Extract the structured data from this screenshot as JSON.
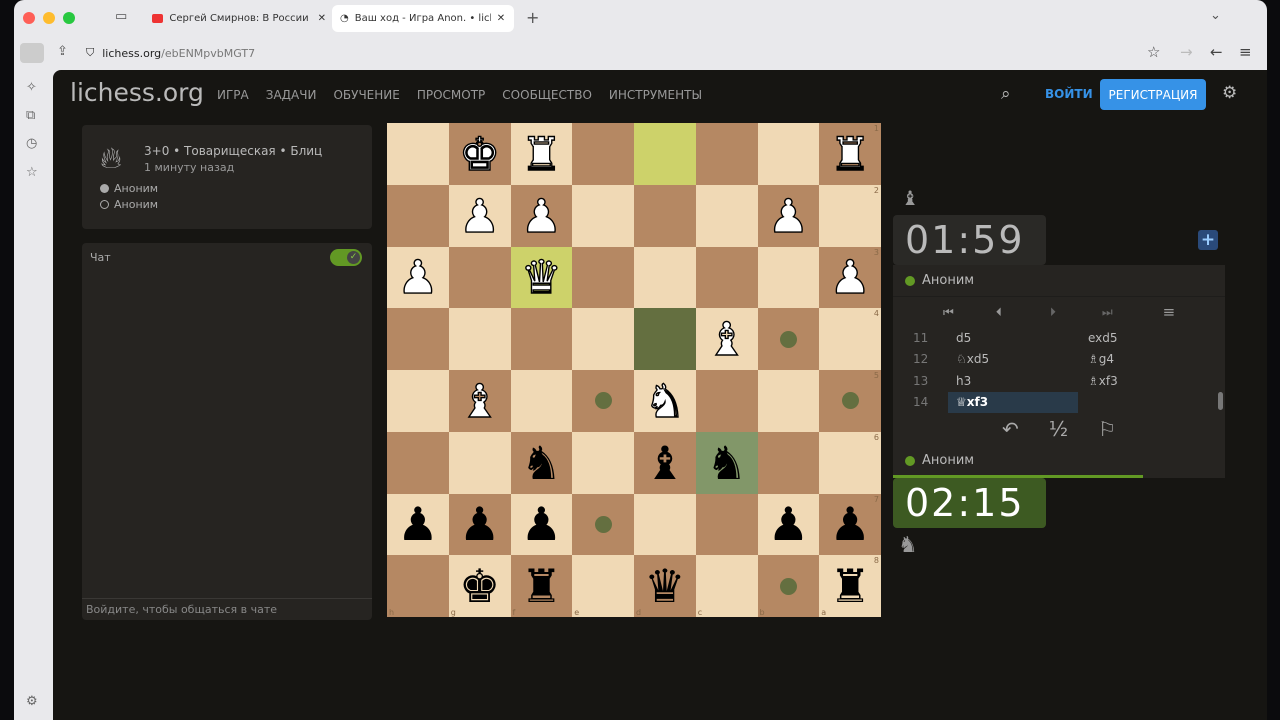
{
  "browser": {
    "tabs": [
      {
        "title": "Сергей Смирнов: В России бо"
      },
      {
        "title": "Ваш ход - Игра Anon. • lichess."
      }
    ],
    "url_host": "lichess.org",
    "url_path": "/ebENMpvbMGT7"
  },
  "header": {
    "logo": "lichess.org",
    "nav": [
      "ИГРА",
      "ЗАДАЧИ",
      "ОБУЧЕНИЕ",
      "ПРОСМОТР",
      "СООБЩЕСТВО",
      "ИНСТРУМЕНТЫ"
    ],
    "login": "ВОЙТИ",
    "signup": "РЕГИСТРАЦИЯ",
    "accent": "#3692e7"
  },
  "game": {
    "info": "3+0 • Товарищеская • Блиц",
    "time_ago": "1 минуту назад",
    "players": [
      "Аноним",
      "Аноним"
    ]
  },
  "chat": {
    "title": "Чат",
    "enabled": true,
    "placeholder": "Войдите, чтобы общаться в чате"
  },
  "board": {
    "orientation": "black",
    "ranks": [
      "1",
      "2",
      "3",
      "4",
      "5",
      "6",
      "7",
      "8"
    ],
    "files": [
      "h",
      "g",
      "f",
      "e",
      "d",
      "c",
      "b",
      "a"
    ],
    "rows": [
      [
        "",
        "wK",
        "wR",
        "",
        "",
        "",
        "",
        "wR"
      ],
      [
        "",
        "wP",
        "wP",
        "",
        "",
        "",
        "wP",
        ""
      ],
      [
        "wP",
        "",
        "wQ",
        "",
        "",
        "",
        "",
        "wP"
      ],
      [
        "",
        "",
        "",
        "",
        "",
        "wB",
        "",
        ""
      ],
      [
        "",
        "wB",
        "",
        "",
        "wN",
        "",
        "",
        ""
      ],
      [
        "",
        "",
        "bN",
        "",
        "bB",
        "bN",
        "",
        ""
      ],
      [
        "bP",
        "bP",
        "bP",
        "",
        "",
        "",
        "bP",
        "bP"
      ],
      [
        "",
        "bK",
        "bR",
        "",
        "bQ",
        "",
        "",
        "bR"
      ]
    ],
    "last_move": [
      "d1",
      "f3"
    ],
    "selected": "c6",
    "move_dots": [
      "b4",
      "e5",
      "a5",
      "e7",
      "b8"
    ]
  },
  "clocks": {
    "top": "01:59",
    "bottom": "02:15",
    "top_player": "Аноним",
    "bottom_player": "Аноним"
  },
  "moves": [
    {
      "n": "11",
      "w": "d5",
      "b": "exd5"
    },
    {
      "n": "12",
      "w": "♘xd5",
      "b": "♗g4"
    },
    {
      "n": "13",
      "w": "h3",
      "b": "♗xf3"
    },
    {
      "n": "14",
      "w": "♕xf3",
      "b": ""
    }
  ],
  "actions": {
    "draw": "½"
  }
}
